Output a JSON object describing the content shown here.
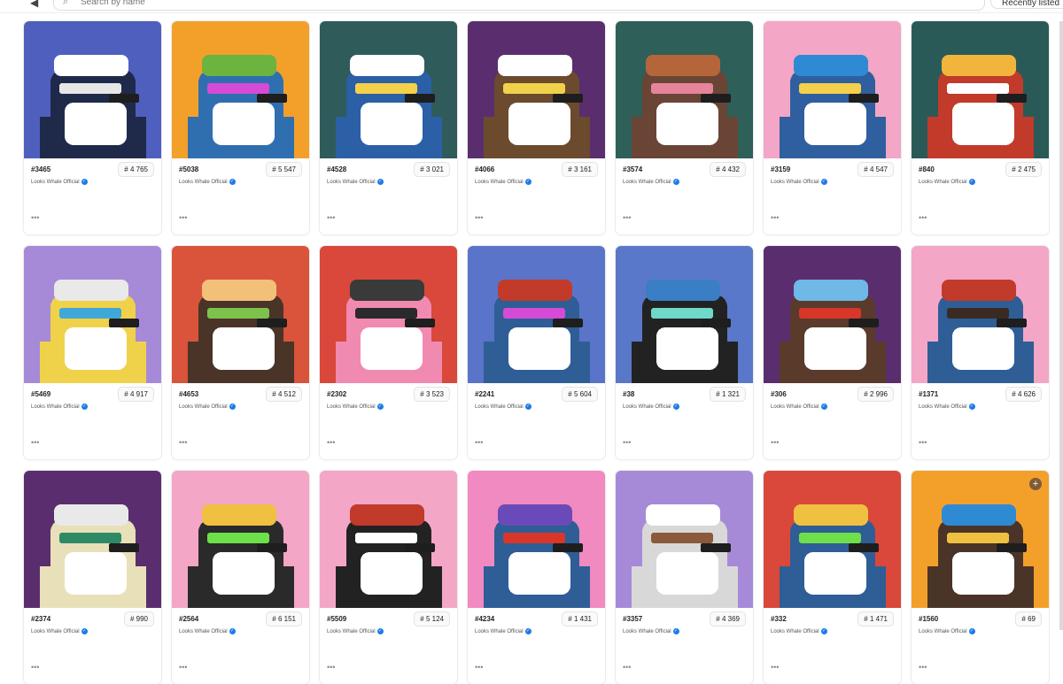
{
  "search": {
    "placeholder": "Search by name"
  },
  "sort": {
    "label": "Recently listed"
  },
  "cards": [
    {
      "id": "#3465",
      "rank": "# 4 765",
      "collection": "Looks Whale Official",
      "more": "•••",
      "bg": "#4f5fbe",
      "body": "#1f2a4a",
      "hat": "#ffffff",
      "acc": "#e7e7e7"
    },
    {
      "id": "#5038",
      "rank": "# 5 547",
      "collection": "Looks Whale Official",
      "more": "•••",
      "bg": "#f3a02b",
      "body": "#2f6fb0",
      "hat": "#6cb33f",
      "acc": "#d54bd5"
    },
    {
      "id": "#4528",
      "rank": "# 3 021",
      "collection": "Looks Whale Official",
      "more": "•••",
      "bg": "#2f5c5a",
      "body": "#2b5fa6",
      "hat": "#ffffff",
      "acc": "#f5d04a"
    },
    {
      "id": "#4066",
      "rank": "# 3 161",
      "collection": "Looks Whale Official",
      "more": "•••",
      "bg": "#5a2e6e",
      "body": "#6b4a2e",
      "hat": "#ffffff",
      "acc": "#f0d24a"
    },
    {
      "id": "#3574",
      "rank": "# 4 432",
      "collection": "Looks Whale Official",
      "more": "•••",
      "bg": "#2e5f58",
      "body": "#6a4536",
      "hat": "#b5653a",
      "acc": "#e7839a"
    },
    {
      "id": "#3159",
      "rank": "# 4 547",
      "collection": "Looks Whale Official",
      "more": "•••",
      "bg": "#f3a6c6",
      "body": "#2f5f9e",
      "hat": "#2f8ad4",
      "acc": "#f5d04a"
    },
    {
      "id": "#840",
      "rank": "# 2 475",
      "collection": "Looks Whale Official",
      "more": "•••",
      "bg": "#2a5a58",
      "body": "#c23a2a",
      "hat": "#f0b53a",
      "acc": "#ffffff"
    },
    {
      "id": "#5469",
      "rank": "# 4 917",
      "collection": "Looks Whale Official",
      "more": "•••",
      "bg": "#a68ad8",
      "body": "#f0d24a",
      "hat": "#e9e9e9",
      "acc": "#3fa8d8"
    },
    {
      "id": "#4653",
      "rank": "# 4 512",
      "collection": "Looks Whale Official",
      "more": "•••",
      "bg": "#d9543a",
      "body": "#4a3428",
      "hat": "#f3c07a",
      "acc": "#7dc24a"
    },
    {
      "id": "#2302",
      "rank": "# 3 523",
      "collection": "Looks Whale Official",
      "more": "•••",
      "bg": "#d9483a",
      "body": "#f08ab0",
      "hat": "#3a3a3a",
      "acc": "#2a2a2a"
    },
    {
      "id": "#2241",
      "rank": "# 5 604",
      "collection": "Looks Whale Official",
      "more": "•••",
      "bg": "#5a74c9",
      "body": "#2e5e95",
      "hat": "#c23a2a",
      "acc": "#d54bd5"
    },
    {
      "id": "#38",
      "rank": "# 1 321",
      "collection": "Looks Whale Official",
      "more": "•••",
      "bg": "#5a78c9",
      "body": "#222222",
      "hat": "#3a7ec6",
      "acc": "#6fd8c8"
    },
    {
      "id": "#306",
      "rank": "# 2 996",
      "collection": "Looks Whale Official",
      "more": "•••",
      "bg": "#5a2e6e",
      "body": "#5a3a2a",
      "hat": "#6fb8e8",
      "acc": "#d9362a"
    },
    {
      "id": "#1371",
      "rank": "# 4 626",
      "collection": "Looks Whale Official",
      "more": "•••",
      "bg": "#f3a6c6",
      "body": "#2e5e95",
      "hat": "#c23a2a",
      "acc": "#3a2a22"
    },
    {
      "id": "#2374",
      "rank": "# 990",
      "collection": "Looks Whale Official",
      "more": "•••",
      "bg": "#5a2e6e",
      "body": "#e8e0b8",
      "hat": "#e9e9e9",
      "acc": "#2e8a66"
    },
    {
      "id": "#2564",
      "rank": "# 6 151",
      "collection": "Looks Whale Official",
      "more": "•••",
      "bg": "#f3a6c6",
      "body": "#2a2a2a",
      "hat": "#f0c040",
      "acc": "#6ee04a"
    },
    {
      "id": "#5509",
      "rank": "# 5 124",
      "collection": "Looks Whale Official",
      "more": "•••",
      "bg": "#f3a6c6",
      "body": "#222222",
      "hat": "#c23a2a",
      "acc": "#ffffff"
    },
    {
      "id": "#4234",
      "rank": "# 1 431",
      "collection": "Looks Whale Official",
      "more": "•••",
      "bg": "#f08ac0",
      "body": "#2e5e95",
      "hat": "#6a4ab8",
      "acc": "#d9362a"
    },
    {
      "id": "#3357",
      "rank": "# 4 369",
      "collection": "Looks Whale Official",
      "more": "•••",
      "bg": "#a68ad8",
      "body": "#d8d8d8",
      "hat": "#ffffff",
      "acc": "#8a5a3a"
    },
    {
      "id": "#332",
      "rank": "# 1 471",
      "collection": "Looks Whale Official",
      "more": "•••",
      "bg": "#d9483a",
      "body": "#2e5e95",
      "hat": "#f0c040",
      "acc": "#6ee04a"
    },
    {
      "id": "#1560",
      "rank": "# 69",
      "collection": "Looks Whale Official",
      "more": "•••",
      "bg": "#f3a02b",
      "body": "#4a3428",
      "hat": "#2f8ad4",
      "acc": "#f0c040",
      "plus": "+"
    }
  ]
}
